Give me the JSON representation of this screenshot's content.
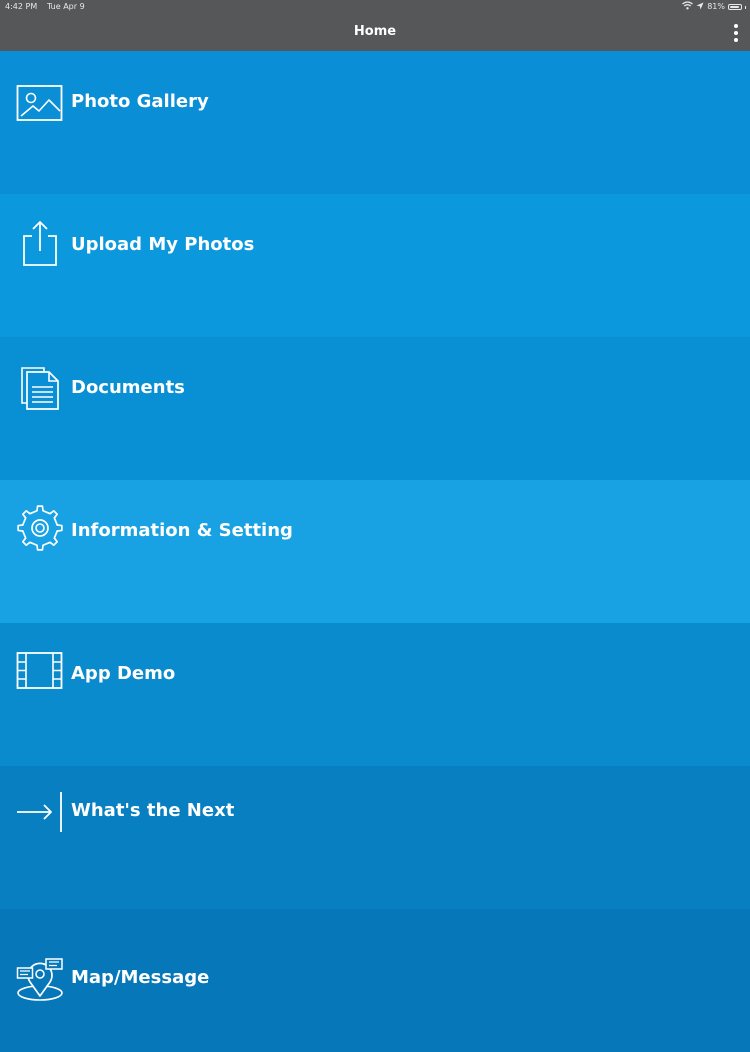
{
  "status_bar": {
    "time": "4:42 PM",
    "date": "Tue Apr 9",
    "battery": "81%"
  },
  "header": {
    "title": "Home"
  },
  "menu": [
    {
      "label": "Photo Gallery",
      "icon": "photo-icon",
      "color": "#0a8fd6"
    },
    {
      "label": "Upload My Photos",
      "icon": "upload-icon",
      "color": "#0b98dd"
    },
    {
      "label": "Documents",
      "icon": "documents-icon",
      "color": "#088fd4"
    },
    {
      "label": "Information & Setting",
      "icon": "gear-icon",
      "color": "#18a1e3"
    },
    {
      "label": "App Demo",
      "icon": "film-icon",
      "color": "#0a8bcd"
    },
    {
      "label": "What's the Next",
      "icon": "arrow-right-icon",
      "color": "#087fc0"
    },
    {
      "label": "Map/Message",
      "icon": "map-message-icon",
      "color": "#0677b8"
    }
  ]
}
